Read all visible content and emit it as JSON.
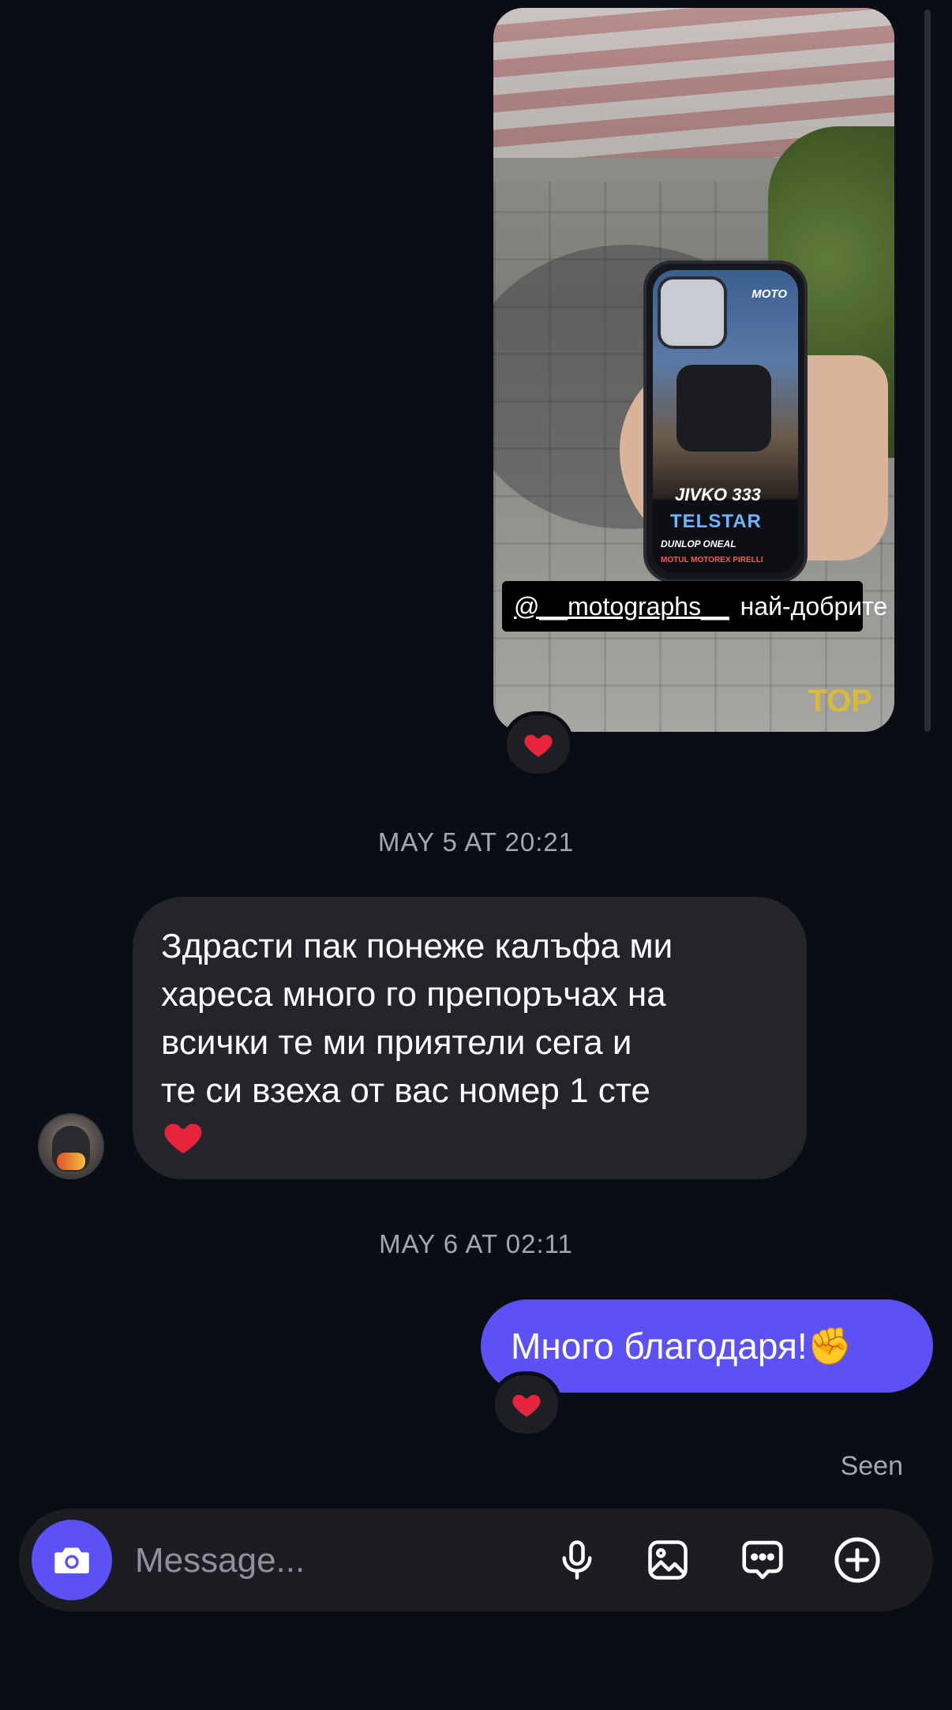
{
  "shared_post": {
    "mention": "@__motographs__",
    "caption_text": "най-добрите",
    "corner_tag": "TOP",
    "phone_case": {
      "brand": "MOTO",
      "rider": "JIVKO  333",
      "team": "TELSTAR",
      "sponsors_line1": "DUNLOP  ONEAL",
      "sponsors_line2": "MOTUL  MOTOREX  PIRELLI"
    },
    "reaction": "heart"
  },
  "timestamps": {
    "first": "MAY 5 AT 20:21",
    "second": "MAY 6 AT 02:11"
  },
  "incoming_message": {
    "text": "Здрасти пак понеже калъфа ми\nхареса много го препоръчах на\nвсички те ми приятели сега и\nте си взеха от вас номер 1 сте",
    "trailing_emoji": "heart"
  },
  "outgoing_message": {
    "text": "Много благодаря!✊",
    "reaction": "heart"
  },
  "status": {
    "seen": "Seen"
  },
  "composer": {
    "placeholder": "Message...",
    "icons": [
      "camera-icon",
      "microphone-icon",
      "gallery-icon",
      "sticker-chat-icon",
      "add-icon"
    ]
  },
  "colors": {
    "background": "#0b0d14",
    "outgoing_bubble": "#5b51f5",
    "incoming_bubble": "#23252b",
    "heart": "#e8243c"
  }
}
